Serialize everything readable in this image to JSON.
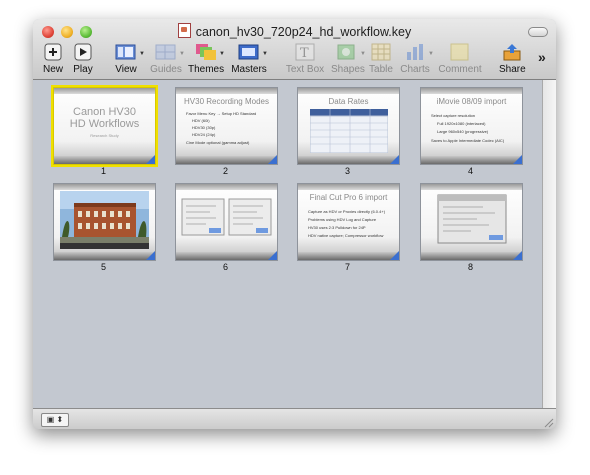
{
  "window": {
    "title": "canon_hv30_720p24_hd_workflow.key"
  },
  "toolbar": {
    "new": "New",
    "play": "Play",
    "view": "View",
    "guides": "Guides",
    "themes": "Themes",
    "masters": "Masters",
    "textbox": "Text Box",
    "shapes": "Shapes",
    "table": "Table",
    "charts": "Charts",
    "comment": "Comment",
    "share": "Share",
    "overflow": "»"
  },
  "slides": [
    {
      "number": "1",
      "title": "Canon HV30\nHD Workflows",
      "subtitle": "Research Study",
      "bullets": []
    },
    {
      "number": "2",
      "title": "HV30 Recording Modes",
      "bullets": [
        "Favor Menu Key → Setup HD Standard",
        "HDV (60i)",
        "HDV30 (30p)",
        "HDV24 (24p)",
        "Cine Mode optional (gamma adjust)"
      ]
    },
    {
      "number": "3",
      "title": "Data Rates",
      "bullets": []
    },
    {
      "number": "4",
      "title": "iMovie 08/09 import",
      "bullets": [
        "Select capture resolution",
        "Full 1920x1080 (interlaced)",
        "Large 960x540 (progressive)",
        "Saves to Apple Intermediate Codec (AIC)"
      ]
    },
    {
      "number": "5",
      "title": "",
      "bullets": []
    },
    {
      "number": "6",
      "title": "",
      "bullets": []
    },
    {
      "number": "7",
      "title": "Final Cut Pro 6 import",
      "bullets": [
        "Capture as HDV or Proxies directly (6.0.4+)",
        "Problems using HDV Log and Capture",
        "HV30 uses 2:3 Pulldown for 24P",
        "HDV native capture; Compressor workflow"
      ]
    },
    {
      "number": "8",
      "title": "",
      "bullets": []
    }
  ],
  "bottombar": {
    "zoom_label": "▣ ⬍"
  }
}
